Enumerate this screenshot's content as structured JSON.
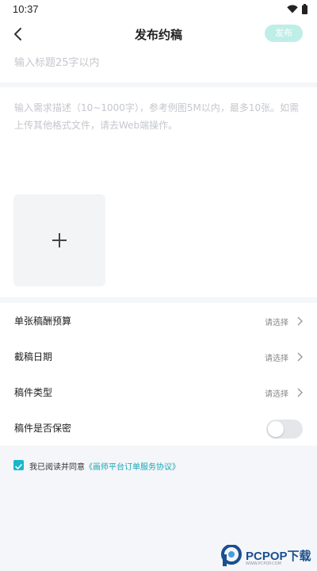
{
  "status_bar": {
    "time": "10:37"
  },
  "header": {
    "title": "发布约稿",
    "publish_label": "发布"
  },
  "title_input": {
    "placeholder": "输入标题25字以内"
  },
  "description": {
    "placeholder": "输入需求描述（10~1000字），参考例图5M以内，最多10张。如需上传其他格式文件，请去Web端操作。"
  },
  "upload": {
    "icon": "plus-icon"
  },
  "form": {
    "rows": [
      {
        "label": "单张稿酬预算",
        "value": "请选择"
      },
      {
        "label": "截稿日期",
        "value": "请选择"
      },
      {
        "label": "稿件类型",
        "value": "请选择"
      }
    ],
    "secret": {
      "label": "稿件是否保密",
      "enabled": false
    }
  },
  "agreement": {
    "checked": true,
    "text": "我已阅读并同意",
    "link": "《画师平台订单服务协议》"
  },
  "watermark": {
    "brand": "PCPOP下载",
    "sub": "WWW.PCPOP.COM"
  },
  "colors": {
    "accent": "#19b7c9",
    "publish_disabled": "#bfeee8",
    "link": "#1aa6b7",
    "background": "#f4f6f9"
  }
}
